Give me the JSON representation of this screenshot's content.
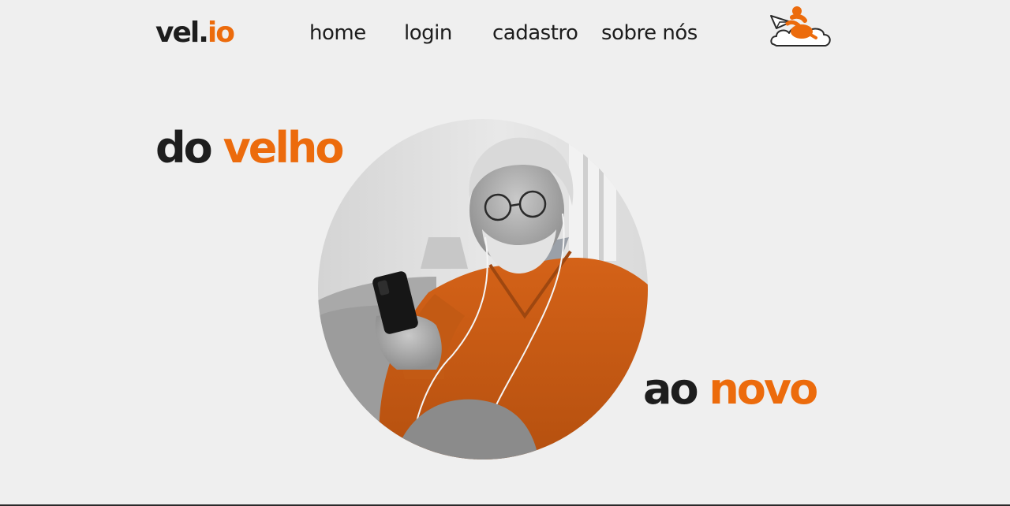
{
  "brand": {
    "name_primary": "vel.",
    "name_accent": "io"
  },
  "nav": {
    "items": [
      {
        "label": "home"
      },
      {
        "label": "login"
      },
      {
        "label": "cadastro"
      },
      {
        "label": "sobre nós"
      }
    ]
  },
  "hero": {
    "line1_dark": "do",
    "line1_accent": "velho",
    "line2_dark": "ao",
    "line2_accent": "novo"
  },
  "colors": {
    "accent": "#ec6b0c",
    "text": "#1d1d1d",
    "background": "#efefef"
  },
  "icons": {
    "mascot": "paper-plane-mascot-on-cloud-icon"
  }
}
